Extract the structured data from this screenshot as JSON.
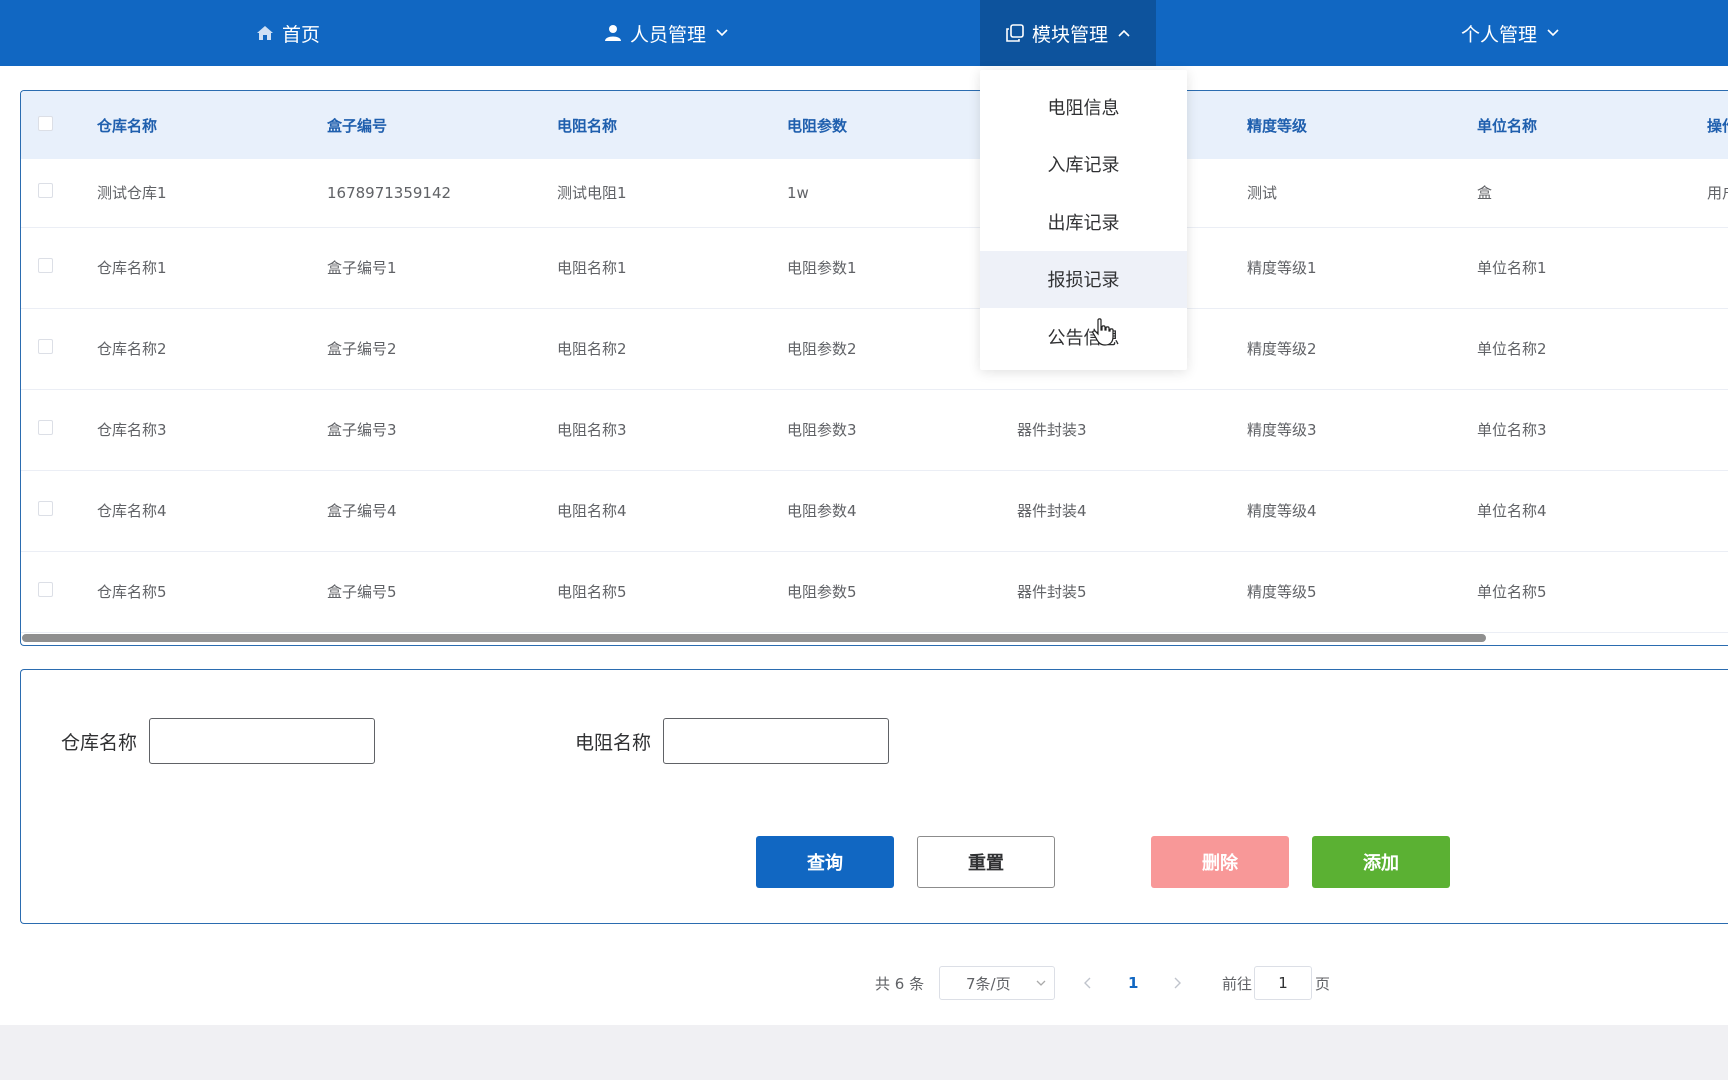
{
  "nav": {
    "home": "首页",
    "personnel": "人员管理",
    "modules": "模块管理",
    "personal": "个人管理"
  },
  "dropdown": {
    "items": [
      "电阻信息",
      "入库记录",
      "出库记录",
      "报损记录",
      "公告信息"
    ]
  },
  "table": {
    "headers": [
      "仓库名称",
      "盒子编号",
      "电阻名称",
      "电阻参数",
      "",
      "精度等级",
      "单位名称",
      "操作"
    ],
    "rows": [
      [
        "测试仓库1",
        "1678971359142",
        "测试电阻1",
        "1w",
        "",
        "测试",
        "盒",
        "用户"
      ],
      [
        "仓库名称1",
        "盒子编号1",
        "电阻名称1",
        "电阻参数1",
        "",
        "精度等级1",
        "单位名称1",
        ""
      ],
      [
        "仓库名称2",
        "盒子编号2",
        "电阻名称2",
        "电阻参数2",
        "",
        "精度等级2",
        "单位名称2",
        ""
      ],
      [
        "仓库名称3",
        "盒子编号3",
        "电阻名称3",
        "电阻参数3",
        "器件封装3",
        "精度等级3",
        "单位名称3",
        ""
      ],
      [
        "仓库名称4",
        "盒子编号4",
        "电阻名称4",
        "电阻参数4",
        "器件封装4",
        "精度等级4",
        "单位名称4",
        ""
      ],
      [
        "仓库名称5",
        "盒子编号5",
        "电阻名称5",
        "电阻参数5",
        "器件封装5",
        "精度等级5",
        "单位名称5",
        ""
      ]
    ]
  },
  "form": {
    "warehouse_label": "仓库名称",
    "warehouse_value": "",
    "resistor_label": "电阻名称",
    "resistor_value": "",
    "query": "查询",
    "reset": "重置",
    "delete": "删除",
    "add": "添加"
  },
  "pagination": {
    "total": "共 6 条",
    "page_size": "7条/页",
    "current_page": "1",
    "goto_label": "前往",
    "goto_value": "1",
    "page_suffix": "页"
  },
  "colors": {
    "nav_bg": "#1167c2",
    "nav_active": "#0d539d",
    "query_btn": "#1167c2",
    "delete_btn": "#f89898",
    "add_btn": "#5bb133"
  }
}
